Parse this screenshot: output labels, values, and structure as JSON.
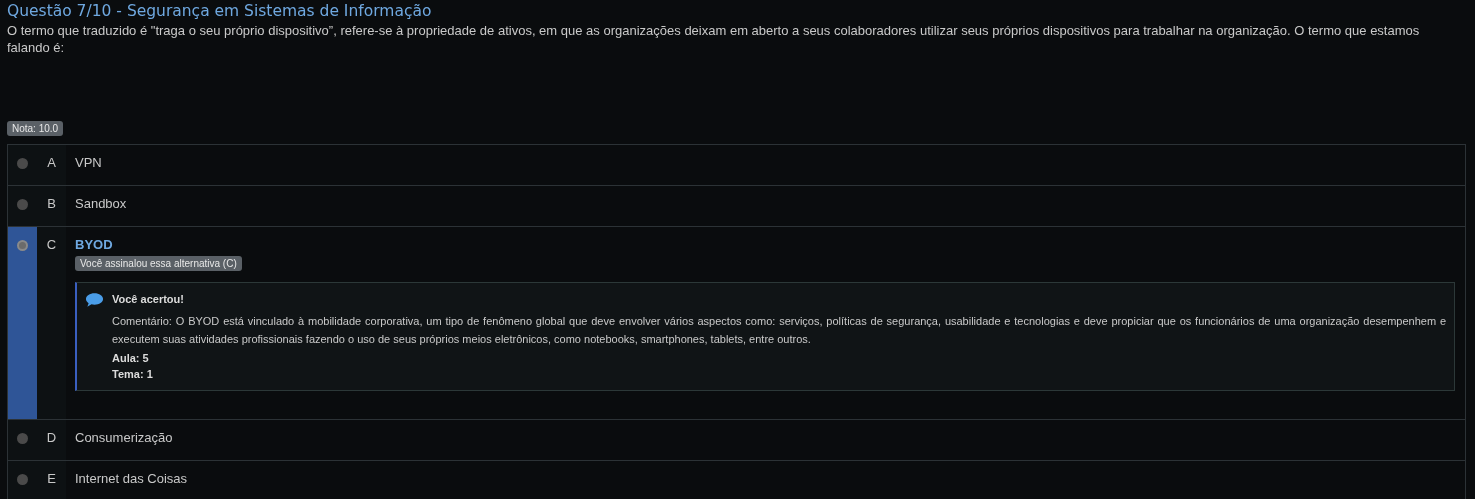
{
  "title": "Questão 7/10 - Segurança em Sistemas de Informação",
  "question": "O termo que traduzido é \"traga o seu próprio dispositivo”, refere-se à propriedade de ativos, em que as organizações deixam em aberto a seus colaboradores utilizar seus próprios dispositivos para trabalhar na organização. O termo que estamos falando é:",
  "grade": "Nota: 10.0",
  "options": [
    {
      "letter": "A",
      "text": "VPN",
      "selected": false
    },
    {
      "letter": "B",
      "text": "Sandbox",
      "selected": false
    },
    {
      "letter": "C",
      "text": "BYOD",
      "selected": true,
      "note": "Você assinalou essa alternativa (C)",
      "feedback": {
        "heading": "Você acertou!",
        "comment": "Comentário: O BYOD está vinculado à mobilidade corporativa, um tipo de fenômeno global que deve envolver vários aspectos como: serviços, políticas de segurança, usabilidade e tecnologias e deve propiciar que os funcionários de uma organização desempenhem e executem suas atividades profissionais fazendo o uso de seus próprios meios eletrônicos, como notebooks, smartphones, tablets, entre outros.",
        "lesson": "Aula: 5",
        "topic": "Tema: 1"
      }
    },
    {
      "letter": "D",
      "text": "Consumerização",
      "selected": false
    },
    {
      "letter": "E",
      "text": "Internet das Coisas",
      "selected": false
    }
  ]
}
